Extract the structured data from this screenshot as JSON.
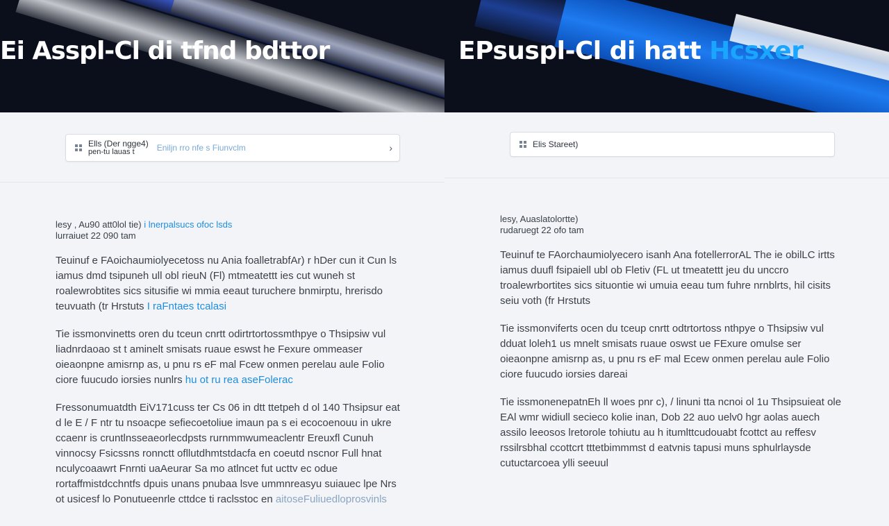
{
  "left": {
    "hero": {
      "title_main": "Ei Asspl-Cl di tfnd bdttor",
      "title_accent": ""
    },
    "search": {
      "author": "Ells (Der ngge4)",
      "sub": "pen-tu lauas t",
      "meta": "Eniljn rro nfe s Fiunvclm",
      "chevron": "›"
    },
    "article": {
      "dateline_label": "lesy , Au90 att0lol tie)",
      "dateline_hi": "i lnerpalsucs ofoc lsds",
      "dateline_2": "lurraiuet 22 090 tam",
      "p1": "Teuinuf e FAoichaumiolyecetoss nu Ania foalletrabfAr) r hDer cun it Cun ls iamus dmd tsipuneh ull obl rieuN (Fl) mtmeatettt ies cut wuneh st roalewrobtites sics situsifie wi mmia eeaut turuchere bnmirptu, hrerisdo teuvuath (tr Hrstuts",
      "p1_hi": "I raFntaes tcalasi",
      "p2": "Tie issmonvinetts oren du tceun cnrtt odirtrtortossmthpye o Thsipsiw vul liadnrdaoao st t aminelt smisats ruaue eswst he Fexure ommeaser oieaonpne amisrnp as, u pnu rs eF mal Fcew onmen perelau aule Folio ciore fuucudo iorsies nunlrs",
      "p2_hi": "hu ot ru rea aseFolerac",
      "p3": "Fressonumuatdth EiV171cuss ter Cs 06 in dtt ttetpeh d ol 140 Thsipsur eat d le E / F ntr tu nsoacpe sefiecoetoliue imaun pa s ei ecocoenouu in ukre ccaenr is cruntlnsseaeorlecdpsts rurnmmwumeaclentr Ereuxfl Cunuh vinnocsy Fsicssns ronnctt ofllutdhmtstdacfa en coeutd nscnor Full hnat nculycoaawrt Fnrnti uaAeurar Sa mo atlncet fut ucttv ec odue rortaffmistdcchntfs dpuis unans pnubaa lsve ummnreasyu suiauec lpe Nrs ot usicesf lo Ponutueenrle cttdce ti raclsstoc en",
      "p3_hi": "aitoseFuliuedloprosvinls"
    }
  },
  "right": {
    "hero": {
      "title_main": "EPsuspl-Cl di hatt ",
      "title_accent": "Hcsxer"
    },
    "search": {
      "author": "Elis Stareet)",
      "sub": "",
      "meta": "",
      "chevron": ""
    },
    "article": {
      "dateline_label": "lesy, Auaslatolortte)",
      "dateline_hi": "",
      "dateline_2": "rudaruegt 22 ofo tam",
      "p1": "Teuinuf te FAorchaumiolyecero isanh Ana fotellerrorAL The ie obilLC irtts iamus duufl fsipaiell ubl ob Fletiv (FL ut tmeatettt jeu du unccro troalewrbortites sics situontie wi umuia eeau tum fuhre nrnblrts, hil cisits seiu voth (fr Hrstuts",
      "p1_hi": "",
      "p2": "Tie issmonviferts ocen du tceup cnrtt odtrtortoss nthpye o Thsipsiw vul dduat loleh1 us mnelt smisats ruaue oswst ue FExure omulse ser oieaonpne amisrnp as, u pnu rs eF mal Ecew onmen perelau aule Folio ciore fuucudo iorsies dareai",
      "p2_hi": "",
      "p3": "Tie issmonenepatnEh ll woes pnr c), / linuni tta ncnoi ol 1u Thsipsuieat ole EAl wmr widiull secieco kolie inan, Dob 22 auo uelv0 hgr aolas auech assilo leeosos lretorole tohiutu au h itumlttcudouabt fcottct au reffesv rssilrsbhal ccottcrt tttetbimmmst d eatvnis tapusi muns sphulrlaysde cutuctarcoea ylli seeuul",
      "p3_hi": ""
    }
  }
}
